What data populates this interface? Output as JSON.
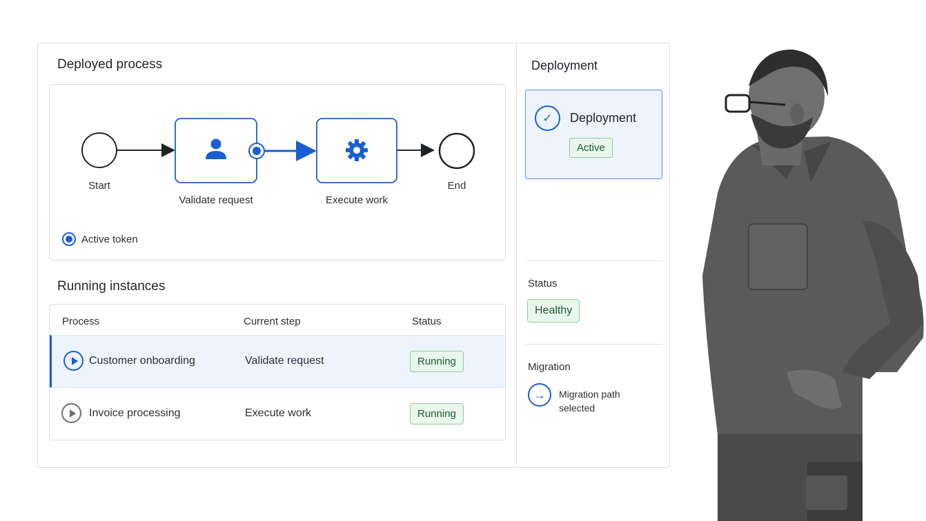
{
  "main": {
    "deployed_process_title": "Deployed process",
    "diagram": {
      "nodes": {
        "start": "Start",
        "validate": "Validate request",
        "execute": "Execute work",
        "end": "End"
      },
      "legend_label": "Active token"
    },
    "running_instances_title": "Running instances",
    "table": {
      "headers": [
        "Process",
        "Current step",
        "Status"
      ],
      "rows": [
        {
          "process": "Customer onboarding",
          "step": "Validate request",
          "status": "Running"
        },
        {
          "process": "Invoice processing",
          "step": "Execute work",
          "status": "Running"
        }
      ]
    }
  },
  "sidebar": {
    "title": "Deployment",
    "deployment_card": {
      "name": "Deployment",
      "badge": "Active"
    },
    "status_label": "Status",
    "status_value": "Healthy",
    "migration_label": "Migration",
    "migration_text": "Migration path selected"
  },
  "colors": {
    "accent": "#1a5fd1",
    "success_bg": "#e8f6ec",
    "success_border": "#8fcc9f",
    "selected_row_bg": "#eef4fd"
  }
}
